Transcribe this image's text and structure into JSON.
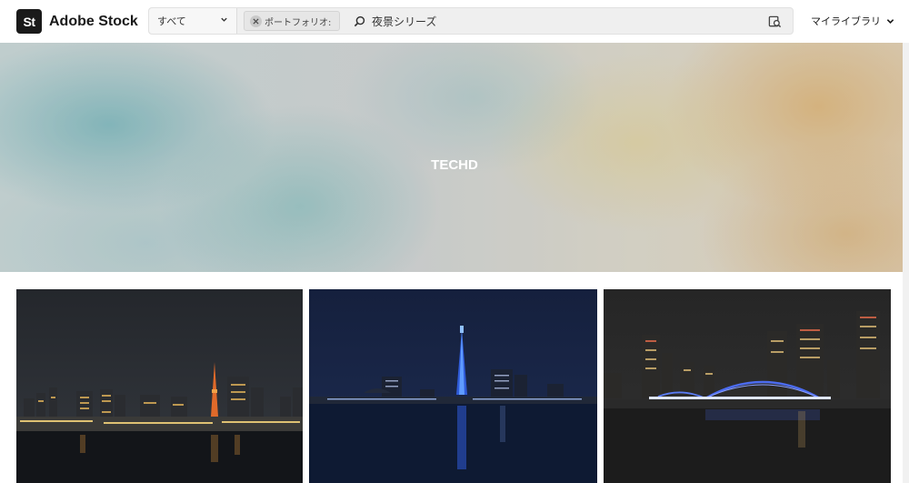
{
  "header": {
    "logo_mark": "St",
    "logo_text": "Adobe Stock",
    "category": {
      "selected": "すべて"
    },
    "filter_chip": {
      "label": "ポートフォリオ:"
    },
    "search": {
      "value": "夜景シリーズ",
      "icon": "search-icon"
    },
    "visual_search_icon": "image-search-icon",
    "library_label": "マイライブラリ"
  },
  "hero": {
    "title": "TECHD"
  },
  "gallery": {
    "images": [
      {
        "name": "tokyo-tower-night-skyline"
      },
      {
        "name": "fukuoka-tower-night-skyline"
      },
      {
        "name": "bridge-night-skyline"
      }
    ]
  },
  "colors": {
    "hero_teal": "#5cb2ba",
    "hero_orange": "#e6aa50",
    "night_sky": "#1c2c46"
  }
}
